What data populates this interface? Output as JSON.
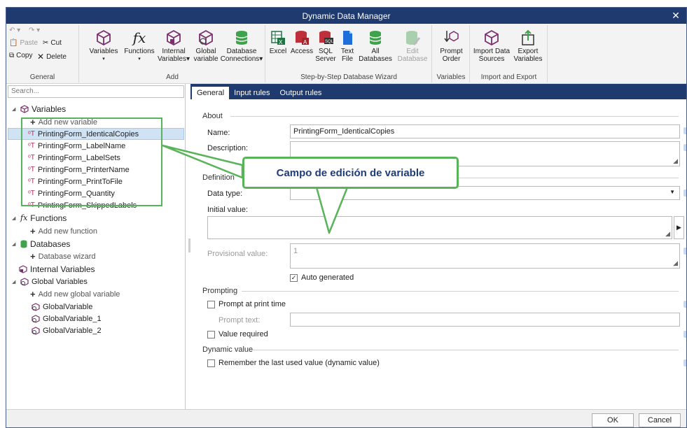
{
  "window": {
    "title": "Dynamic Data Manager",
    "close_glyph": "✕"
  },
  "ribbon": {
    "general": {
      "label": "General",
      "paste": "Paste",
      "cut": "Cut",
      "copy": "Copy",
      "delete": "Delete"
    },
    "add": {
      "label": "Add",
      "variables": "Variables",
      "functions": "Functions",
      "internal": "Internal",
      "internal2": "Variables",
      "global": "Global",
      "global2": "variable",
      "database": "Database",
      "database2": "Connections"
    },
    "wizard": {
      "label": "Step-by-Step Database Wizard",
      "excel": "Excel",
      "access": "Access",
      "sql": "SQL",
      "sql2": "Server",
      "text": "Text",
      "text2": "File",
      "all": "All",
      "all2": "Databases",
      "edit": "Edit",
      "edit2": "Database"
    },
    "variables_group": {
      "label": "Variables",
      "prompt": "Prompt",
      "prompt2": "Order"
    },
    "import_export": {
      "label": "Import and Export",
      "import": "Import Data",
      "import2": "Sources",
      "export": "Export",
      "export2": "Variables"
    }
  },
  "left": {
    "search_placeholder": "Search...",
    "tree": {
      "variables": "Variables",
      "add_variable": "Add new variable",
      "items": [
        "PrintingForm_IdenticalCopies",
        "PrintingForm_LabelName",
        "PrintingForm_LabelSets",
        "PrintingForm_PrinterName",
        "PrintingForm_PrintToFile",
        "PrintingForm_Quantity",
        "PrintingForm_SkippedLabels"
      ],
      "functions": "Functions",
      "add_function": "Add new function",
      "databases": "Databases",
      "database_wizard": "Database wizard",
      "internal_variables": "Internal Variables",
      "global_variables": "Global Variables",
      "add_global": "Add new global variable",
      "globals": [
        "GlobalVariable",
        "GlobalVariable_1",
        "GlobalVariable_2"
      ]
    }
  },
  "tabs": [
    "General",
    "Input rules",
    "Output rules"
  ],
  "form": {
    "about": "About",
    "name_label": "Name:",
    "name_value": "PrintingForm_IdenticalCopies",
    "description_label": "Description:",
    "definition": "Definition",
    "data_type_label": "Data type:",
    "initial_value_label": "Initial value:",
    "provisional_label": "Provisional value:",
    "provisional_value": "1",
    "auto_generated": "Auto generated",
    "prompting": "Prompting",
    "prompt_at_print": "Prompt at print time",
    "prompt_text_label": "Prompt text:",
    "value_required": "Value required",
    "dynamic_value": "Dynamic value",
    "remember_last": "Remember the last used value (dynamic value)"
  },
  "footer": {
    "ok": "OK",
    "cancel": "Cancel"
  },
  "callout": {
    "text": "Campo de edición de variable"
  },
  "colors": {
    "accent": "#1e3a6e",
    "highlight": "#59b359",
    "callout_text": "#1f3c78"
  }
}
